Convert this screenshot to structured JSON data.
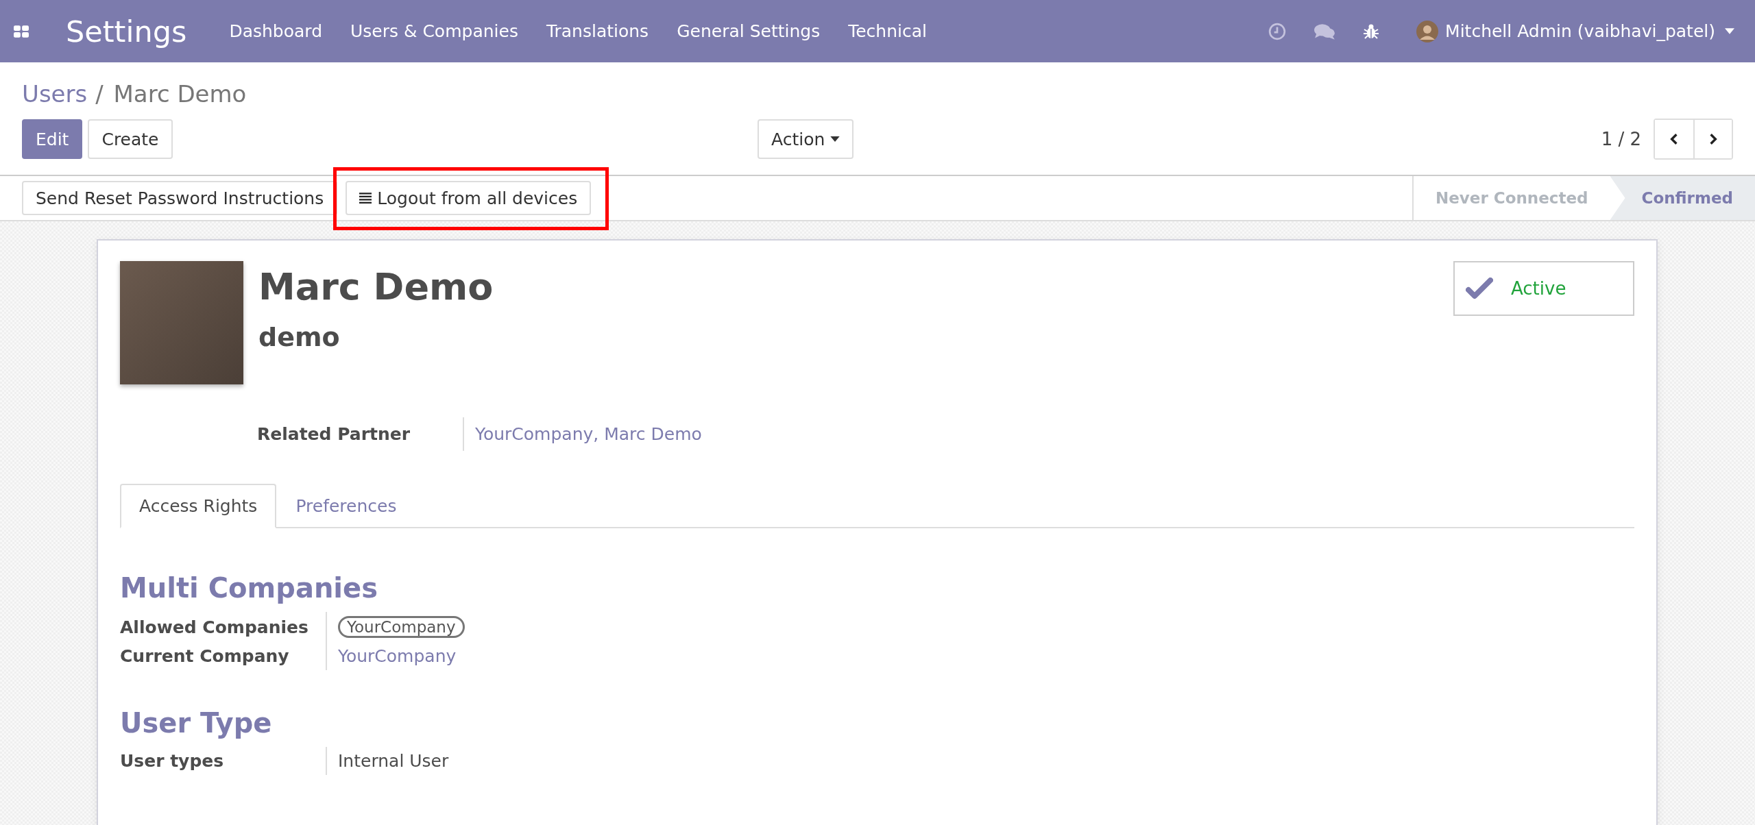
{
  "navbar": {
    "app_title": "Settings",
    "menu": [
      "Dashboard",
      "Users & Companies",
      "Translations",
      "General Settings",
      "Technical"
    ],
    "user": "Mitchell Admin (vaibhavi_patel)"
  },
  "breadcrumb": {
    "parent": "Users",
    "separator": "/",
    "current": "Marc Demo"
  },
  "buttons": {
    "edit": "Edit",
    "create": "Create",
    "action": "Action"
  },
  "pager": {
    "value": "1 / 2"
  },
  "header_buttons": [
    {
      "label": "Send Reset Password Instructions",
      "highlighted": false
    },
    {
      "label": "Logout from all devices",
      "highlighted": true
    }
  ],
  "stages": [
    {
      "label": "Never Connected",
      "selected": false
    },
    {
      "label": "Confirmed",
      "selected": true
    }
  ],
  "form": {
    "name": "Marc Demo",
    "login": "demo",
    "active_toggle": {
      "label": "Active",
      "on": true
    },
    "related_partner": {
      "label": "Related Partner",
      "value": "YourCompany, Marc Demo"
    },
    "tabs": [
      {
        "label": "Access Rights",
        "selected": true
      },
      {
        "label": "Preferences",
        "selected": false
      }
    ],
    "sections": [
      {
        "title": "Multi Companies",
        "fields": [
          {
            "label": "Allowed Companies",
            "value": "YourCompany",
            "kind": "tag"
          },
          {
            "label": "Current Company",
            "value": "YourCompany",
            "kind": "link"
          }
        ]
      },
      {
        "title": "User Type",
        "fields": [
          {
            "label": "User types",
            "value": "Internal User",
            "kind": "text"
          }
        ]
      }
    ]
  }
}
